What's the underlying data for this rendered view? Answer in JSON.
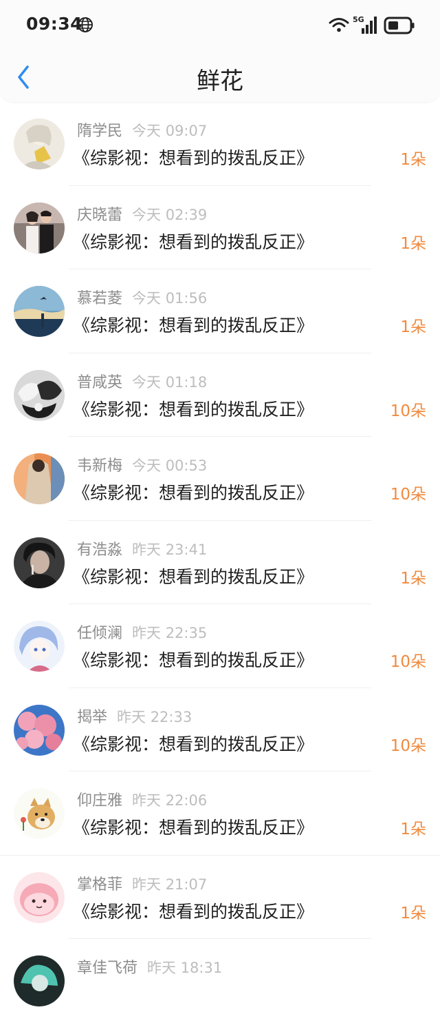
{
  "status_bar": {
    "time": "09:34",
    "network_type": "5G",
    "icons": [
      "globe-icon",
      "wifi-icon",
      "signal-icon",
      "battery-icon"
    ]
  },
  "nav": {
    "title": "鲜花",
    "back_icon": "chevron-left-icon"
  },
  "colors": {
    "accent": "#2f8cf0",
    "count": "#f08a3e",
    "name": "#8c8c8c",
    "time": "#bdbdbd",
    "text": "#1f1f1f"
  },
  "items": [
    {
      "name": "隋学民",
      "time": "今天 09:07",
      "book": "《综影视：想看到的拨乱反正》",
      "count": "1朵"
    },
    {
      "name": "庆晓蕾",
      "time": "今天 02:39",
      "book": "《综影视：想看到的拨乱反正》",
      "count": "1朵"
    },
    {
      "name": "慕若菱",
      "time": "今天 01:56",
      "book": "《综影视：想看到的拨乱反正》",
      "count": "1朵"
    },
    {
      "name": "普咸英",
      "time": "今天 01:18",
      "book": "《综影视：想看到的拨乱反正》",
      "count": "10朵"
    },
    {
      "name": "韦新梅",
      "time": "今天 00:53",
      "book": "《综影视：想看到的拨乱反正》",
      "count": "10朵"
    },
    {
      "name": "有浩淼",
      "time": "昨天 23:41",
      "book": "《综影视：想看到的拨乱反正》",
      "count": "1朵"
    },
    {
      "name": "任倾澜",
      "time": "昨天 22:35",
      "book": "《综影视：想看到的拨乱反正》",
      "count": "10朵"
    },
    {
      "name": "揭举",
      "time": "昨天 22:33",
      "book": "《综影视：想看到的拨乱反正》",
      "count": "10朵"
    },
    {
      "name": "仰庄雅",
      "time": "昨天 22:06",
      "book": "《综影视：想看到的拨乱反正》",
      "count": "1朵"
    },
    {
      "name": "掌格菲",
      "time": "昨天 21:07",
      "book": "《综影视：想看到的拨乱反正》",
      "count": "1朵"
    },
    {
      "name": "章佳飞荷",
      "time": "昨天 18:31",
      "book": "",
      "count": ""
    }
  ]
}
